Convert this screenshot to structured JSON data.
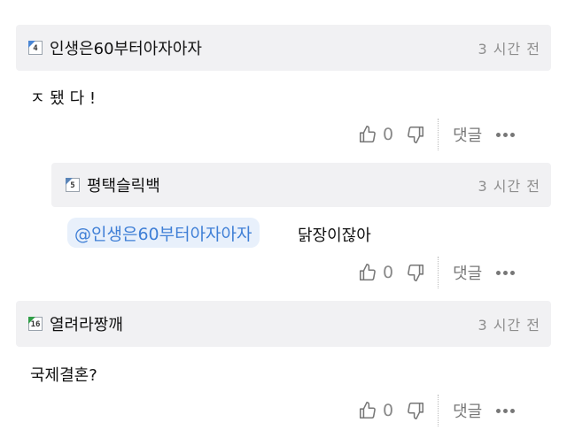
{
  "comments": [
    {
      "level": "4",
      "nick": "인생은60부터아자아자",
      "time": "3 시간 전",
      "text": "ㅈ 됐 다 !",
      "likes": "0",
      "reply_label": "댓글"
    },
    {
      "level": "5",
      "nick": "평택슬릭백",
      "time": "3 시간 전",
      "mention": "@인생은60부터아자아자",
      "text": "닭장이잖아",
      "likes": "0",
      "reply_label": "댓글"
    },
    {
      "level": "16",
      "nick": "열려라짱깨",
      "time": "3 시간 전",
      "text": "국제결혼?",
      "likes": "0",
      "reply_label": "댓글"
    }
  ],
  "icons": {
    "like": "thumbs-up-icon",
    "dislike": "thumbs-down-icon",
    "more": "more-dots-icon"
  },
  "colors": {
    "header_bg": "#f1f1f3",
    "mention_bg": "#e8f0fb",
    "mention_text": "#3f7fd6",
    "level_blue": "#4a86d4",
    "level_green": "#2f9d47"
  }
}
